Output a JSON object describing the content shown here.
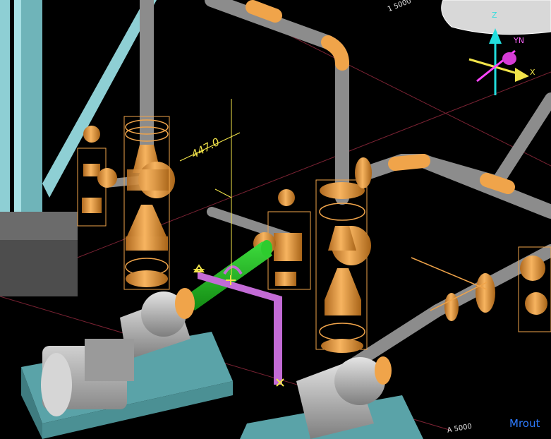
{
  "viewport": {
    "mode_label": "Mrout",
    "dimension_value": "447.0",
    "grid_labels": {
      "top": "1 5000",
      "bottom": "A 5000"
    },
    "axis_triad": {
      "x_label": "X",
      "y_label": "YN",
      "z_label": "Z"
    }
  },
  "colors": {
    "background": "#000000",
    "pipe": "#8c8c8c",
    "fittings": "#f0a44a",
    "selected_pipe": "#22a822",
    "route_preview": "#c36bd6",
    "structure": "#8ecfd4",
    "equipment": "#b8b8b8",
    "dimension": "#f2e44a",
    "grid_line": "#7a2233",
    "mode_label": "#2e7bff",
    "axis_x": "#f2e44a",
    "axis_y": "#ff44ff",
    "axis_z": "#22dddd"
  },
  "icons": {
    "start_marker": "triangle-icon",
    "cursor": "crosshair-icon",
    "end_marker": "x-mark-icon"
  }
}
